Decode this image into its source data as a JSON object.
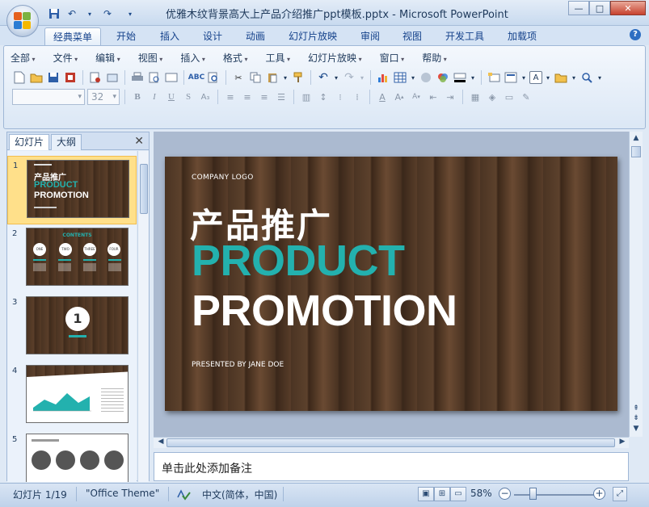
{
  "window": {
    "title": "优雅木纹背景高大上产品介绍推广ppt模板.pptx - Microsoft PowerPoint",
    "minimize": "—",
    "maximize": "□",
    "close": "✕"
  },
  "qat": {
    "save_icon": "save-icon",
    "undo_icon": "undo-icon",
    "redo_icon": "redo-icon"
  },
  "ribbon_tabs": [
    "经典菜单",
    "开始",
    "插入",
    "设计",
    "动画",
    "幻灯片放映",
    "审阅",
    "视图",
    "开发工具",
    "加载项"
  ],
  "menu": [
    "全部",
    "文件",
    "编辑",
    "视图",
    "插入",
    "格式",
    "工具",
    "幻灯片放映",
    "窗口",
    "帮助"
  ],
  "font": {
    "name": "",
    "size": "32"
  },
  "panel": {
    "tab_slides": "幻灯片",
    "tab_outline": "大纲",
    "close": "✕"
  },
  "thumbnails": [
    {
      "num": "1",
      "selected": true
    },
    {
      "num": "2",
      "selected": false
    },
    {
      "num": "3",
      "selected": false
    },
    {
      "num": "4",
      "selected": false
    },
    {
      "num": "5",
      "selected": false
    }
  ],
  "thumb1": {
    "cn": "产品推广",
    "product": "PRODUCT",
    "promo": "PROMOTION"
  },
  "thumb2": {
    "heading": "CONTENTS",
    "items": [
      "ONE",
      "TWO",
      "THREE",
      "FOUR"
    ]
  },
  "thumb3": {
    "number": "1"
  },
  "slide": {
    "logo": "COMPANY LOGO",
    "title_cn": "产品推广",
    "title_en1": "PRODUCT",
    "title_en2": "PROMOTION",
    "presenter": "PRESENTED BY JANE DOE",
    "accent": "#23b1ae"
  },
  "notes": {
    "placeholder": "单击此处添加备注"
  },
  "status": {
    "slide": "幻灯片 1/19",
    "theme": "\"Office Theme\"",
    "language": "中文(简体，中国)",
    "zoom": "58%"
  }
}
